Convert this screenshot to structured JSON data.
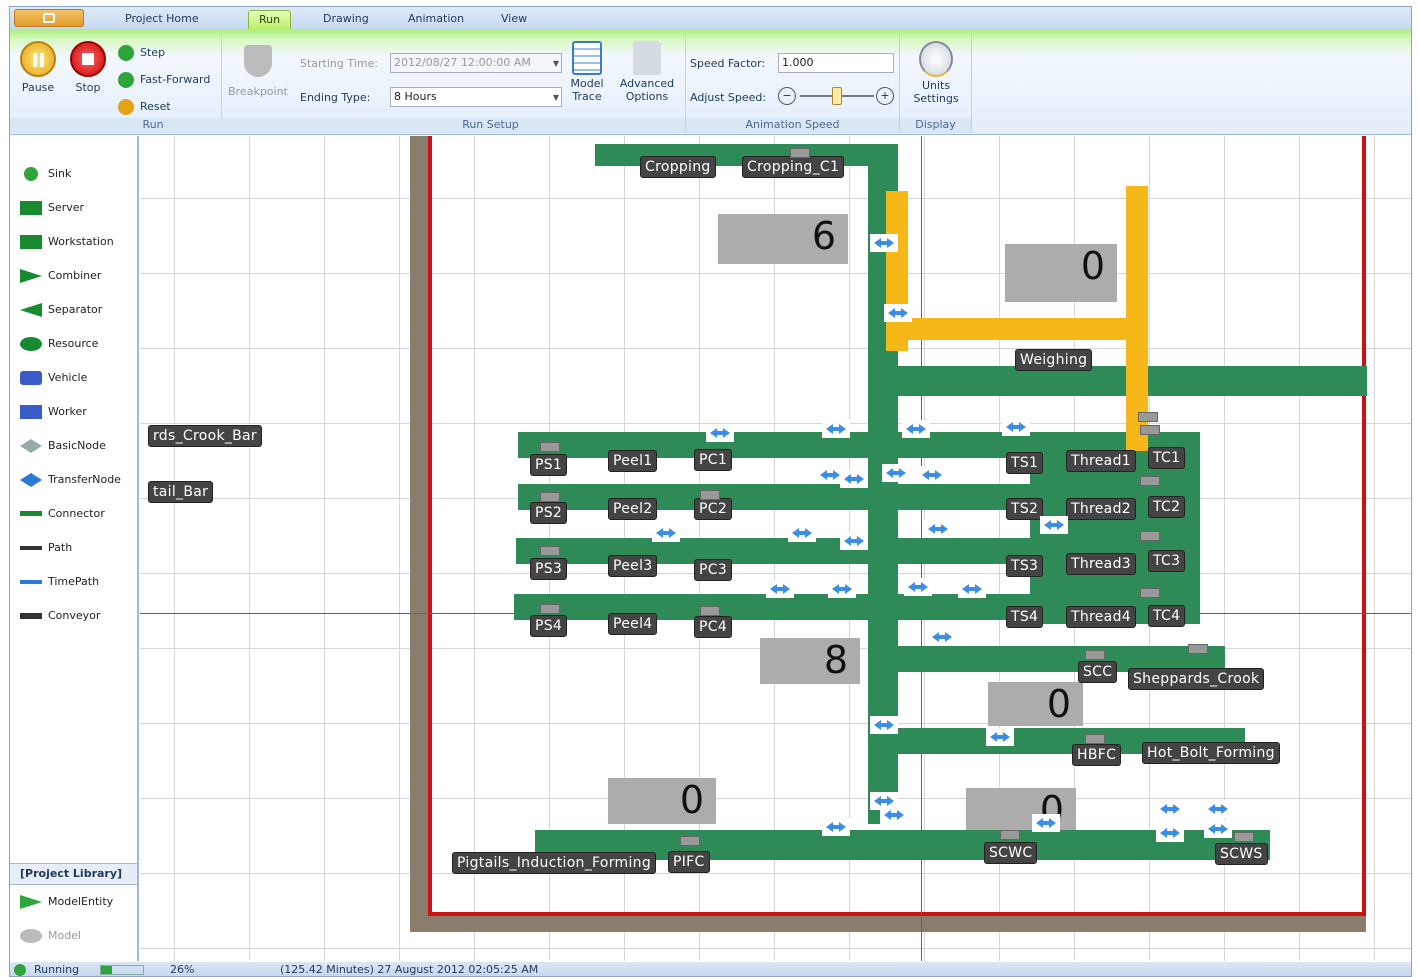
{
  "tabs": [
    "Project Home",
    "Run",
    "Drawing",
    "Animation",
    "View"
  ],
  "active_tab": "Run",
  "ribbon": {
    "run": {
      "pause": "Pause",
      "stop": "Stop",
      "step": "Step",
      "fast_forward": "Fast-Forward",
      "reset": "Reset",
      "breakpoint": "Breakpoint",
      "group": "Run"
    },
    "run_setup": {
      "starting_time_label": "Starting Time:",
      "starting_time_value": "2012/08/27 12:00:00 AM",
      "ending_type_label": "Ending Type:",
      "ending_type_value": "8 Hours",
      "model_trace": "Model Trace",
      "advanced_options": "Advanced Options",
      "group": "Run Setup"
    },
    "animation_speed": {
      "speed_factor_label": "Speed Factor:",
      "speed_factor_value": "1.000",
      "adjust_speed_label": "Adjust Speed:",
      "slider_level": 0.5,
      "group": "Animation Speed"
    },
    "display": {
      "units_settings": "Units Settings",
      "group": "Display"
    }
  },
  "sidebar": {
    "items": [
      {
        "label": "Sink",
        "icon": "sink-icon"
      },
      {
        "label": "Server",
        "icon": "server-icon"
      },
      {
        "label": "Workstation",
        "icon": "workstation-icon"
      },
      {
        "label": "Combiner",
        "icon": "combiner-icon"
      },
      {
        "label": "Separator",
        "icon": "separator-icon"
      },
      {
        "label": "Resource",
        "icon": "resource-icon"
      },
      {
        "label": "Vehicle",
        "icon": "vehicle-icon"
      },
      {
        "label": "Worker",
        "icon": "worker-icon"
      },
      {
        "label": "BasicNode",
        "icon": "basicnode-icon"
      },
      {
        "label": "TransferNode",
        "icon": "transfernode-icon"
      },
      {
        "label": "Connector",
        "icon": "connector-icon"
      },
      {
        "label": "Path",
        "icon": "path-icon"
      },
      {
        "label": "TimePath",
        "icon": "timepath-icon"
      },
      {
        "label": "Conveyor",
        "icon": "conveyor-icon"
      }
    ],
    "project_library": "[Project Library]",
    "library_items": [
      {
        "label": "ModelEntity"
      },
      {
        "label": "Model"
      }
    ]
  },
  "canvas": {
    "counters": [
      "6",
      "0",
      "8",
      "0",
      "0",
      "0"
    ],
    "labels": {
      "cropping": "Cropping",
      "cropping_c1": "Cropping_C1",
      "weighing": "Weighing",
      "crook_bar": "rds_Crook_Bar",
      "tail_bar": "tail_Bar",
      "ps1": "PS1",
      "peel1": "Peel1",
      "pc1": "PC1",
      "ts1": "TS1",
      "thread1": "Thread1",
      "tc1": "TC1",
      "ps2": "PS2",
      "peel2": "Peel2",
      "pc2": "PC2",
      "ts2": "TS2",
      "thread2": "Thread2",
      "tc2": "TC2",
      "ps3": "PS3",
      "peel3": "Peel3",
      "pc3": "PC3",
      "ts3": "TS3",
      "thread3": "Thread3",
      "tc3": "TC3",
      "ps4": "PS4",
      "peel4": "Peel4",
      "pc4": "PC4",
      "ts4": "TS4",
      "thread4": "Thread4",
      "tc4": "TC4",
      "scc": "SCC",
      "sheppards_crook": "Sheppards_Crook",
      "hbfc": "HBFC",
      "hot_bolt_forming": "Hot_Bolt_Forming",
      "pigtails": "Pigtails_Induction_Forming",
      "pifc": "PIFC",
      "scwc": "SCWC",
      "scws": "SCWS"
    }
  },
  "status": {
    "state": "Running",
    "progress": "26%",
    "progress_value": 0.26,
    "time": "(125.42 Minutes) 27 August 2012 02:05:25 AM"
  },
  "colors": {
    "path": "#2e8b57",
    "worker_path": "#f6b719",
    "boundary": "#cc1111",
    "wall": "#8b7d6b"
  }
}
